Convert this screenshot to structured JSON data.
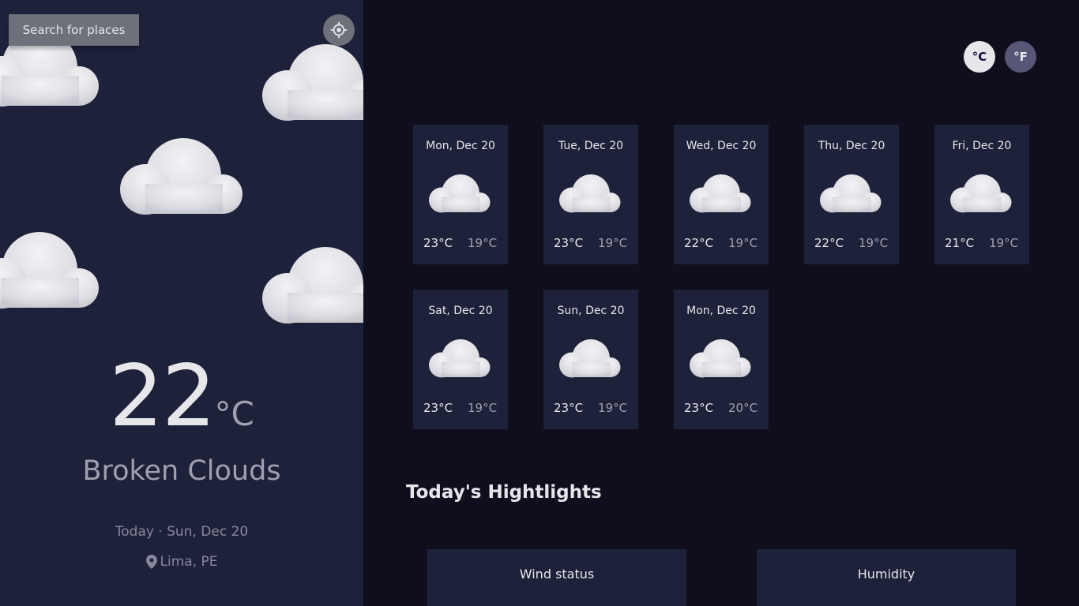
{
  "sidebar": {
    "search_label": "Search for places",
    "locate_icon": "crosshair-icon",
    "temperature": "22",
    "temperature_unit": "°C",
    "condition": "Broken Clouds",
    "today_label": "Today",
    "separator": "·",
    "today_date": "Sun, Dec 20",
    "location": "Lima, PE",
    "location_icon": "map-pin-icon"
  },
  "units": {
    "celsius": "°C",
    "fahrenheit": "°F",
    "active": "celsius"
  },
  "forecast": [
    {
      "day": "Mon, Dec 20",
      "max": "23°C",
      "min": "19°C",
      "icon": "cloud-icon"
    },
    {
      "day": "Tue, Dec 20",
      "max": "23°C",
      "min": "19°C",
      "icon": "cloud-icon"
    },
    {
      "day": "Wed, Dec 20",
      "max": "22°C",
      "min": "19°C",
      "icon": "cloud-icon"
    },
    {
      "day": "Thu, Dec 20",
      "max": "22°C",
      "min": "19°C",
      "icon": "cloud-icon"
    },
    {
      "day": "Fri, Dec 20",
      "max": "21°C",
      "min": "19°C",
      "icon": "cloud-icon"
    },
    {
      "day": "Sat, Dec 20",
      "max": "23°C",
      "min": "19°C",
      "icon": "cloud-icon"
    },
    {
      "day": "Sun, Dec 20",
      "max": "23°C",
      "min": "19°C",
      "icon": "cloud-icon"
    },
    {
      "day": "Mon, Dec 20",
      "max": "23°C",
      "min": "20°C",
      "icon": "cloud-icon"
    }
  ],
  "highlights": {
    "title": "Today's Hightlights",
    "cards": [
      {
        "label": "Wind status"
      },
      {
        "label": "Humidity"
      }
    ]
  },
  "colors": {
    "sidebar_bg": "#1e213a",
    "page_bg": "#100e1d",
    "card_bg": "#1e213a",
    "text_primary": "#e7e7eb",
    "text_secondary": "#a09fb1",
    "button_gray": "#6e707a",
    "unit_inactive": "#585676"
  }
}
